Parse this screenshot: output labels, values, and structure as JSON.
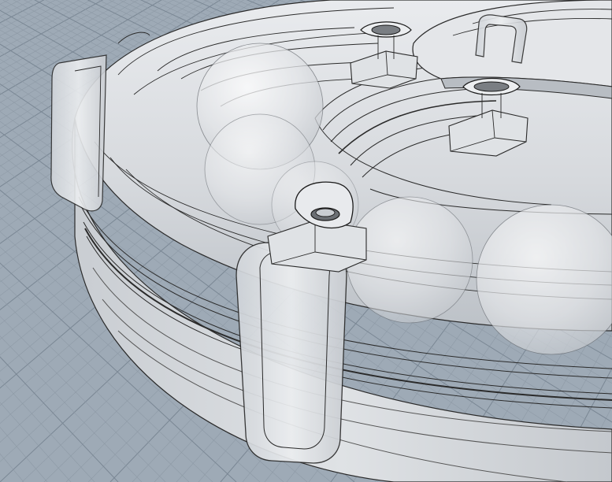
{
  "viewport": {
    "background_color": "#9eaab6",
    "grid_minor_color": "#8e9aa6",
    "grid_major_color": "#7a8794",
    "model_fill_color": "#d7d9dc",
    "model_highlight_color": "#eef0f2",
    "model_shade_color": "#b9bec4",
    "edge_color": "#2a2a2a"
  }
}
